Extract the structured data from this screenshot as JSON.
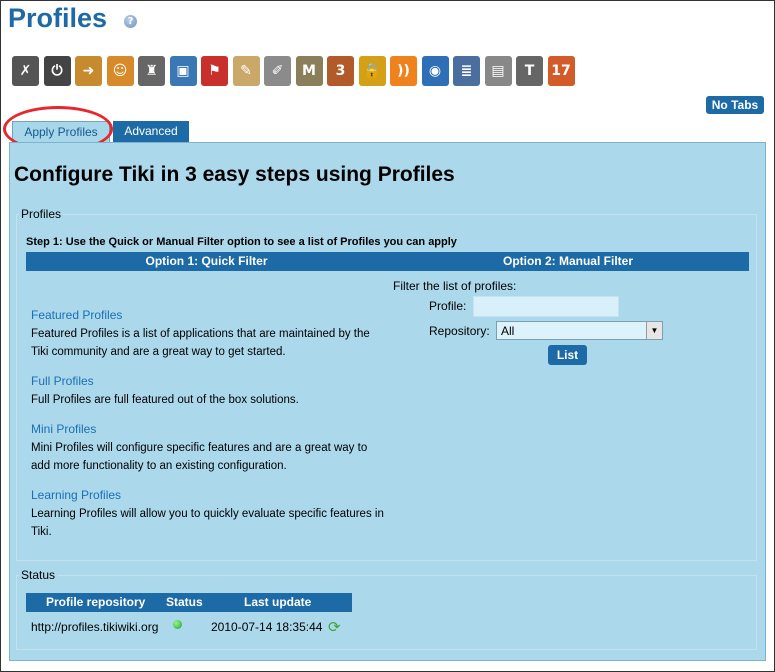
{
  "page": {
    "title": "Profiles",
    "help_icon": "?"
  },
  "toolbar": {
    "icons": [
      {
        "name": "tools-icon",
        "glyph": "✗",
        "color": "#555"
      },
      {
        "name": "power-icon",
        "glyph": "⏻",
        "color": "#444"
      },
      {
        "name": "login-icon",
        "glyph": "➜",
        "color": "#c88a2e"
      },
      {
        "name": "users-icon",
        "glyph": "☺",
        "color": "#d88a2a"
      },
      {
        "name": "silhouette-icon",
        "glyph": "♜",
        "color": "#666"
      },
      {
        "name": "look-icon",
        "glyph": "▣",
        "color": "#3a78b5"
      },
      {
        "name": "flag-icon",
        "glyph": "⚑",
        "color": "#c9302c"
      },
      {
        "name": "notepad-icon",
        "glyph": "✎",
        "color": "#caa86a"
      },
      {
        "name": "edit-icon",
        "glyph": "✐",
        "color": "#8b8b8b"
      },
      {
        "name": "mail-icon",
        "glyph": "M",
        "color": "#8a7e5b"
      },
      {
        "name": "calendar-hourglass-icon",
        "glyph": "3",
        "color": "#b35a2a"
      },
      {
        "name": "lock-icon",
        "glyph": "🔒",
        "color": "#d4a017"
      },
      {
        "name": "rss-icon",
        "glyph": "))",
        "color": "#f0821e"
      },
      {
        "name": "globe-icon",
        "glyph": "◉",
        "color": "#2e6fb5"
      },
      {
        "name": "articles-icon",
        "glyph": "≣",
        "color": "#4a6ea0"
      },
      {
        "name": "files-icon",
        "glyph": "▤",
        "color": "#888"
      },
      {
        "name": "text-icon",
        "glyph": "T",
        "color": "#666"
      },
      {
        "name": "calendar-icon",
        "glyph": "17",
        "color": "#d35b2a"
      }
    ]
  },
  "no_tabs_label": "No Tabs",
  "tabs": [
    {
      "label": "Apply Profiles",
      "active": true
    },
    {
      "label": "Advanced",
      "active": false
    }
  ],
  "main": {
    "heading": "Configure Tiki in 3 easy steps using Profiles",
    "profiles_legend": "Profiles",
    "step1": "Step 1: Use the Quick or Manual Filter option to see a list of Profiles you can apply",
    "option1": "Option 1: Quick Filter",
    "option2": "Option 2: Manual Filter",
    "quick": [
      {
        "title": "Featured Profiles",
        "desc": "Featured Profiles is a list of applications that are maintained by the Tiki community and are a great way to get started."
      },
      {
        "title": "Full Profiles",
        "desc": "Full Profiles are full featured out of the box solutions."
      },
      {
        "title": "Mini Profiles",
        "desc": "Mini Profiles will configure specific features and are a great way to add more functionality to an existing configuration."
      },
      {
        "title": "Learning Profiles",
        "desc": "Learning Profiles will allow you to quickly evaluate specific features in Tiki."
      }
    ],
    "manual": {
      "filter_label": "Filter the list of profiles:",
      "profile_label": "Profile:",
      "profile_value": "",
      "repository_label": "Repository:",
      "repository_value": "All",
      "list_button": "List"
    }
  },
  "status": {
    "legend": "Status",
    "headers": [
      "Profile repository",
      "Status",
      "Last update"
    ],
    "row": {
      "repository": "http://profiles.tikiwiki.org",
      "status": "ok",
      "last_update": "2010-07-14 18:35:44"
    }
  }
}
